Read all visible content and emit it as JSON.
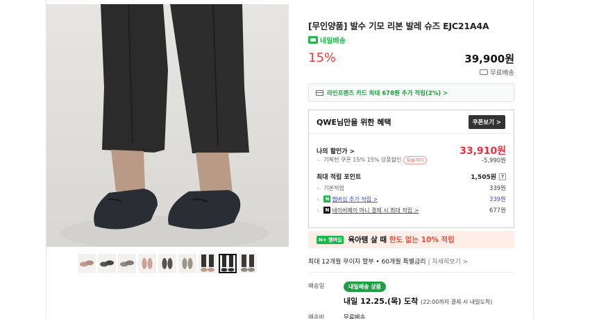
{
  "gallery": {
    "thumbnails": [
      "thumb-1",
      "thumb-2",
      "thumb-3",
      "thumb-4",
      "thumb-5",
      "thumb-6",
      "thumb-7",
      "thumb-8",
      "thumb-9"
    ],
    "selected_index": 7
  },
  "product": {
    "title": "[무인양품] 발수 기모 리본 발레 슈즈 EJC21A4A",
    "today_badge": "내일배송",
    "discount": "15%",
    "price": "39,900원",
    "shipping": "무료배송"
  },
  "card_banner": {
    "text": "라인프렌즈 카드 최대 678원 추가 적립(2%) >"
  },
  "benefits": {
    "title": "QWE님만을 위한 혜택",
    "coupon_button": "쿠폰보기 >",
    "my_price_label": "나의 할인가 >",
    "my_price_value": "33,910원",
    "coupon_line": "기획전 쿠폰 15% 15% 상품할인",
    "coupon_tag": "오늘까지",
    "coupon_amount": "-5,990원",
    "points_label": "최대 적립 포인트",
    "points_value": "1,505원",
    "points_help": "?",
    "basic_label": "기본적립",
    "basic_value": "339원",
    "membership_label": "멤버십 추가 적립 >",
    "membership_value": "339원",
    "naverpay_label": "네이버페이 머니 결제 시 최대 적립 >",
    "naverpay_value": "677원"
  },
  "promo": {
    "membership_tag": "N+ 멤버십",
    "text_prefix": "육아템 살 때 ",
    "text_highlight": "한도 없는 10% 적립"
  },
  "installment": {
    "text": "최대 12개월 무이자 할부 • 60개월 특별금리",
    "more": "자세히보기 >"
  },
  "delivery": {
    "date_label": "배송일",
    "pill": "내일배송 상품",
    "arrive": "내일 12.25.(목) 도착",
    "arrive_note": "(22:00까지 결제 시 내일도착)",
    "fee_label": "배송비",
    "fee_value": "무료배송"
  },
  "colors": {
    "accent_red": "#f03e3e",
    "naver_green": "#20b84a",
    "link_blue": "#3b4fd4"
  }
}
